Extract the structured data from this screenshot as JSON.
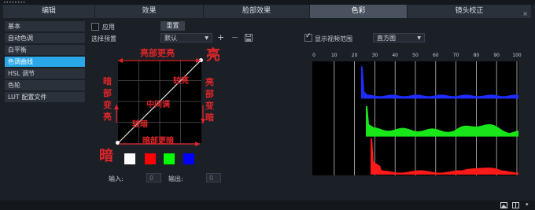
{
  "tabs": [
    {
      "label": "编辑",
      "active": false
    },
    {
      "label": "效果",
      "active": false
    },
    {
      "label": "脸部效果",
      "active": false
    },
    {
      "label": "色彩",
      "active": true
    },
    {
      "label": "镜头校正",
      "active": false
    }
  ],
  "tab_close": "×",
  "sidebar": {
    "items": [
      {
        "label": "基本",
        "active": false
      },
      {
        "label": "自动色调",
        "active": false
      },
      {
        "label": "白平衡",
        "active": false
      },
      {
        "label": "色调曲线",
        "active": true
      },
      {
        "label": "HSL 调节",
        "active": false
      },
      {
        "label": "色轮",
        "active": false
      },
      {
        "label": "LUT 配置文件",
        "active": false
      }
    ]
  },
  "apply": {
    "label": "应用",
    "checked": false
  },
  "reset_label": "重置",
  "preset": {
    "label": "选择预置",
    "value": "默认"
  },
  "show_scope": {
    "label": "显示视频范围",
    "checked": true
  },
  "scope_select": {
    "value": "直方图"
  },
  "annotations": {
    "bright_big": "亮",
    "dark_big": "暗",
    "highlights_brighter": "亮部更亮",
    "shadows_darker": "暗部更暗",
    "shadows_vertical": "暗部变亮",
    "highlights_vertical": "亮部变暗",
    "brighter": "较亮",
    "midtones": "中间调",
    "darker": "较暗"
  },
  "swatch_colors": [
    "#ffffff",
    "#ff0000",
    "#00ff00",
    "#0000ff"
  ],
  "input": {
    "label": "输入:",
    "value": "0"
  },
  "output": {
    "label": "输出:",
    "value": "0"
  },
  "histogram": {
    "ticks": [
      "0",
      "10",
      "20",
      "30",
      "40",
      "50",
      "60",
      "70",
      "80",
      "90",
      "100"
    ],
    "channels": [
      {
        "name": "blue",
        "color": "#1e2cff"
      },
      {
        "name": "green",
        "color": "#19e619"
      },
      {
        "name": "red",
        "color": "#ff1a1a"
      }
    ]
  },
  "colors": {
    "accent": "#2aa7e8",
    "annotation": "#e0262a"
  }
}
